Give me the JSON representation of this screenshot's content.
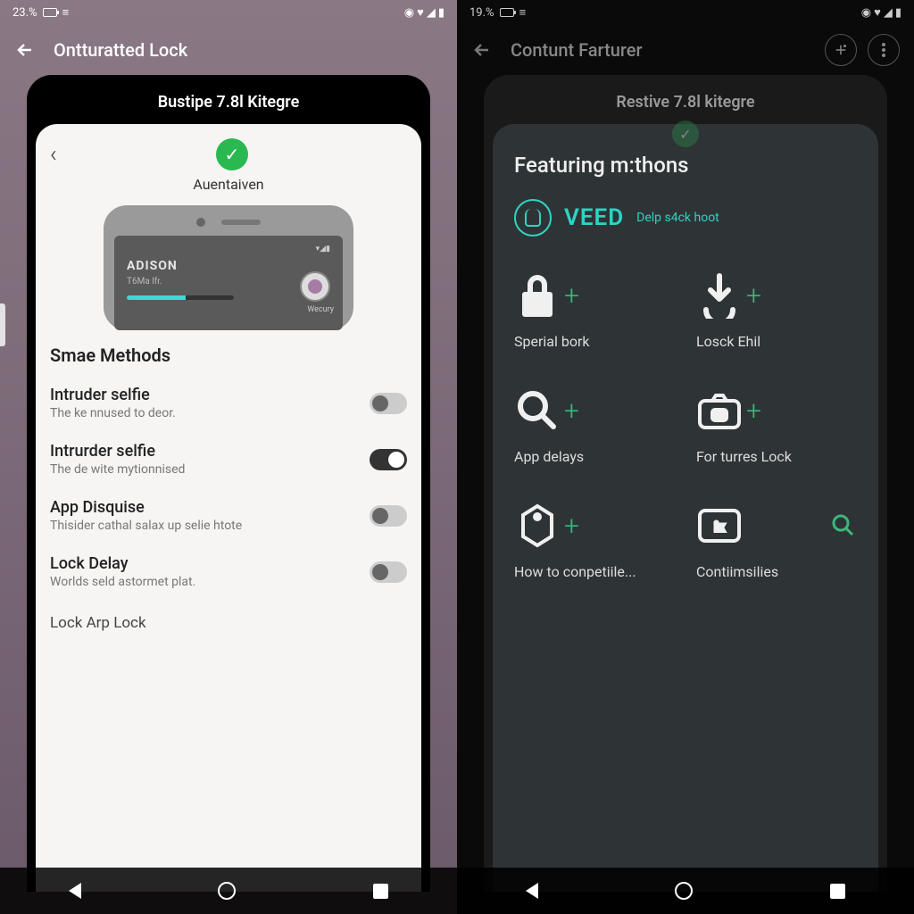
{
  "left": {
    "status": {
      "time": "23.%",
      "icons": "◉ ♥ ◢ ▮"
    },
    "header_title": "Ontturatted Lock",
    "frame_title": "Bustipe 7.8l Kitegre",
    "card_sub": "Auentaiven",
    "mock": {
      "name": "ADISON",
      "sub": "T6Ma lfr.",
      "avatar_label": "Wecury"
    },
    "section_title": "Smae Methods",
    "settings": [
      {
        "title": "Intruder selfie",
        "desc": "The ke nnused to deor.",
        "on": false
      },
      {
        "title": "Intrurder selfie",
        "desc": "The de wite mytionnised",
        "on": true
      },
      {
        "title": "App Disquise",
        "desc": "Thisider cathal salax up selie htote",
        "on": false
      },
      {
        "title": "Lock Delay",
        "desc": "Worlds seld astormet plat.",
        "on": false
      }
    ],
    "last_item": "Lock Arp Lock"
  },
  "right": {
    "status": {
      "time": "19.%",
      "icons": "◉ ♥ ◢ ▮"
    },
    "header_title": "Contunt Farturer",
    "frame_title": "Restive 7.8l kitegre",
    "feat_title": "Featuring m:thons",
    "brand": "VEED",
    "brand_sub": "Delp s4ck hoot",
    "tiles": [
      {
        "label": "Sperial bork"
      },
      {
        "label": "Losck Ehil"
      },
      {
        "label": "App delays"
      },
      {
        "label": "For turres Lock"
      },
      {
        "label": "How to conpetiile..."
      },
      {
        "label": "Contiimsilies"
      }
    ]
  }
}
